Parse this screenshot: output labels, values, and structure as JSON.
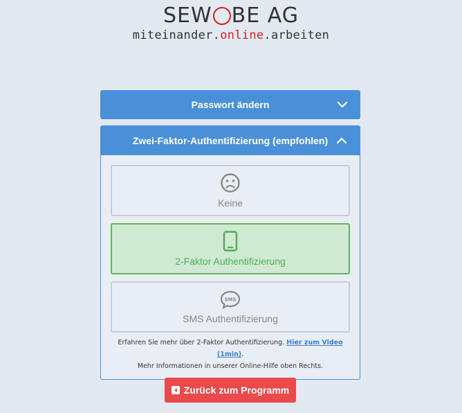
{
  "logo": {
    "title_part1": "SEW",
    "title_part2": "BE AG",
    "sub_part1": "miteinander.",
    "sub_part2": "online",
    "sub_part3": ".arbeiten"
  },
  "password_panel": {
    "title": "Passwort ändern",
    "icon": "chevron-down-icon"
  },
  "twofa_panel": {
    "title": "Zwei-Faktor-Authentifizierung (empfohlen)",
    "icon": "chevron-up-icon",
    "options": [
      {
        "label": "Keine",
        "icon": "sad-face-icon",
        "selected": false
      },
      {
        "label": "2-Faktor Authentifizierung",
        "icon": "mobile-phone-icon",
        "selected": true
      },
      {
        "label": "SMS Authentifizierung",
        "icon": "sms-bubble-icon",
        "selected": false
      }
    ],
    "info_line1_text": "Erfahren Sie mehr über 2-Faktor Authentifizierung. ",
    "info_link": "Hier zum Video (1min)",
    "info_line1_end": ".",
    "info_line2": "Mehr Informationen in unserer Online-Hilfe oben Rechts."
  },
  "back_button": {
    "label": "Zurück zum Programm",
    "icon": "caret-left-icon"
  },
  "colors": {
    "accent": "#4a90d9",
    "success": "#5cb85c",
    "danger": "#ea4a4a",
    "brand_red": "#d62020"
  }
}
